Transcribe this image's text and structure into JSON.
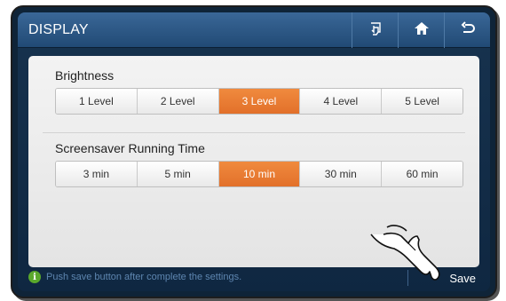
{
  "header": {
    "title": "DISPLAY",
    "icons": [
      "touch-icon",
      "home-icon",
      "back-icon"
    ]
  },
  "brightness": {
    "label": "Brightness",
    "options": [
      "1 Level",
      "2 Level",
      "3 Level",
      "4 Level",
      "5 Level"
    ],
    "selected": "3 Level"
  },
  "screensaver": {
    "label": "Screensaver Running Time",
    "options": [
      "3 min",
      "5 min",
      "10 min",
      "30 min",
      "60 min"
    ],
    "selected": "10 min"
  },
  "footer": {
    "hint": "Push save button after complete the settings.",
    "save_label": "Save"
  },
  "colors": {
    "accent": "#e8782f",
    "title_bar": "#2c5886",
    "background": "#142d47",
    "info": "#5aa82c"
  }
}
